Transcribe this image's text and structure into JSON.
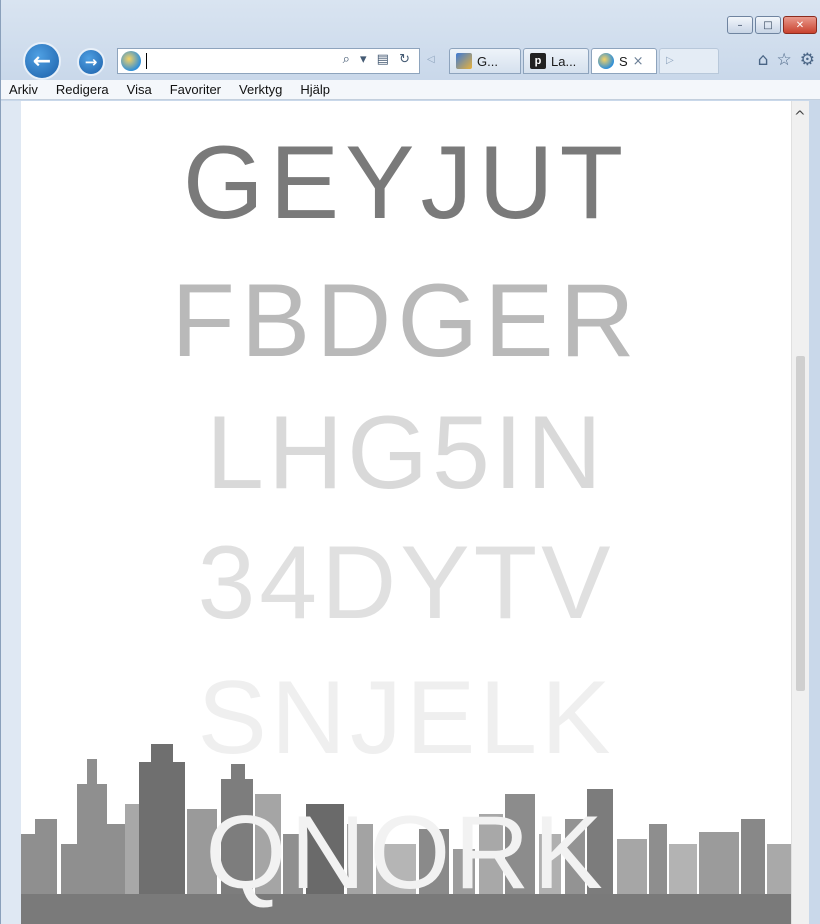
{
  "window": {
    "controls": {
      "minimize": "–",
      "maximize": "□",
      "close": "✕"
    }
  },
  "navigation": {
    "back_icon": "←",
    "forward_icon": "→",
    "address_value": "",
    "address_tools": "⌕ ▾ ▤ ↻"
  },
  "tabs": [
    {
      "label": "G...",
      "icon": "g-tab-icon",
      "active": false
    },
    {
      "label": "La...",
      "icon": "p-tab-icon",
      "icon_glyph": "p",
      "active": false
    },
    {
      "label": "S",
      "icon": "ie-tab-icon",
      "active": true,
      "close": "×"
    }
  ],
  "tab_scroll_left": "◁",
  "new_tab_arrow": "▷",
  "toolbar": {
    "home": "⌂",
    "favorites": "☆",
    "settings": "⚙"
  },
  "menu": [
    "Arkiv",
    "Redigera",
    "Visa",
    "Favoriter",
    "Verktyg",
    "Hjälp"
  ],
  "eye_chart": {
    "rows": [
      {
        "text": "GEYJUT",
        "color": "#7a7a7a"
      },
      {
        "text": "FBDGER",
        "color": "#b9b9b9"
      },
      {
        "text": "LHG5IN",
        "color": "#d9d9d9"
      },
      {
        "text": "34DYTV",
        "color": "#e0e0e0"
      },
      {
        "text": "SNJELK",
        "color": "#efefef"
      },
      {
        "text": "QNORK",
        "color": "#f2f2f2"
      }
    ]
  },
  "scrollbar": {
    "up_arrow": "^"
  }
}
